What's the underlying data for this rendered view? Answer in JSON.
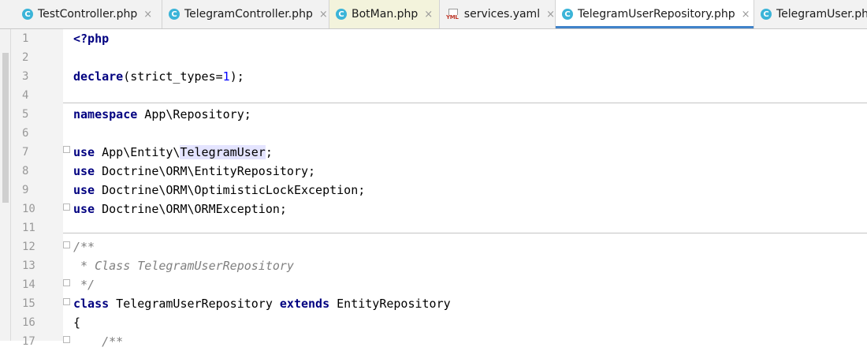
{
  "tabs": [
    {
      "label": "TestController.php",
      "icon": "class-icon"
    },
    {
      "label": "TelegramController.php",
      "icon": "class-icon"
    },
    {
      "label": "BotMan.php",
      "icon": "class-icon"
    },
    {
      "label": "services.yaml",
      "icon": "yml-icon",
      "icon_text": "YML"
    },
    {
      "label": "TelegramUserRepository.php",
      "icon": "class-icon"
    },
    {
      "label": "TelegramUser.ph",
      "icon": "class-icon"
    }
  ],
  "class_icon_letter": "C",
  "close_glyph": "×",
  "colors": {
    "keyword": "#000080",
    "number": "#0000ff",
    "comment": "#808080",
    "active_tab_underline": "#4083c9"
  },
  "editor": {
    "lines": [
      {
        "n": "1",
        "parts": [
          {
            "t": "<?php",
            "c": "kw"
          }
        ]
      },
      {
        "n": "2",
        "parts": []
      },
      {
        "n": "3",
        "parts": [
          {
            "t": "declare",
            "c": "kw"
          },
          {
            "t": "(strict_types="
          },
          {
            "t": "1",
            "c": "num"
          },
          {
            "t": ");"
          }
        ]
      },
      {
        "n": "4",
        "parts": []
      },
      {
        "n": "5",
        "parts": [
          {
            "t": "namespace",
            "c": "kw"
          },
          {
            "t": " App\\Repository;"
          }
        ]
      },
      {
        "n": "6",
        "parts": []
      },
      {
        "n": "7",
        "parts": [
          {
            "t": "use",
            "c": "kw"
          },
          {
            "t": " App\\Entity\\"
          },
          {
            "t": "TelegramUser",
            "c": "hl"
          },
          {
            "t": ";"
          }
        ]
      },
      {
        "n": "8",
        "parts": [
          {
            "t": "use",
            "c": "kw"
          },
          {
            "t": " Doctrine\\ORM\\EntityRepository;"
          }
        ]
      },
      {
        "n": "9",
        "parts": [
          {
            "t": "use",
            "c": "kw"
          },
          {
            "t": " Doctrine\\ORM\\OptimisticLockException;"
          }
        ]
      },
      {
        "n": "10",
        "parts": [
          {
            "t": "use",
            "c": "kw"
          },
          {
            "t": " Doctrine\\ORM\\ORMException;"
          }
        ]
      },
      {
        "n": "11",
        "parts": []
      },
      {
        "n": "12",
        "parts": [
          {
            "t": "/**",
            "c": "cmt"
          }
        ]
      },
      {
        "n": "13",
        "parts": [
          {
            "t": " * Class TelegramUserRepository",
            "c": "cmt"
          }
        ]
      },
      {
        "n": "14",
        "parts": [
          {
            "t": " */",
            "c": "cmt"
          }
        ]
      },
      {
        "n": "15",
        "parts": [
          {
            "t": "class",
            "c": "kw"
          },
          {
            "t": " TelegramUserRepository "
          },
          {
            "t": "extends",
            "c": "kw"
          },
          {
            "t": " EntityRepository"
          }
        ]
      },
      {
        "n": "16",
        "parts": [
          {
            "t": "{"
          }
        ]
      },
      {
        "n": "17",
        "parts": [
          {
            "t": "    /**",
            "c": "cmt"
          }
        ]
      }
    ]
  }
}
